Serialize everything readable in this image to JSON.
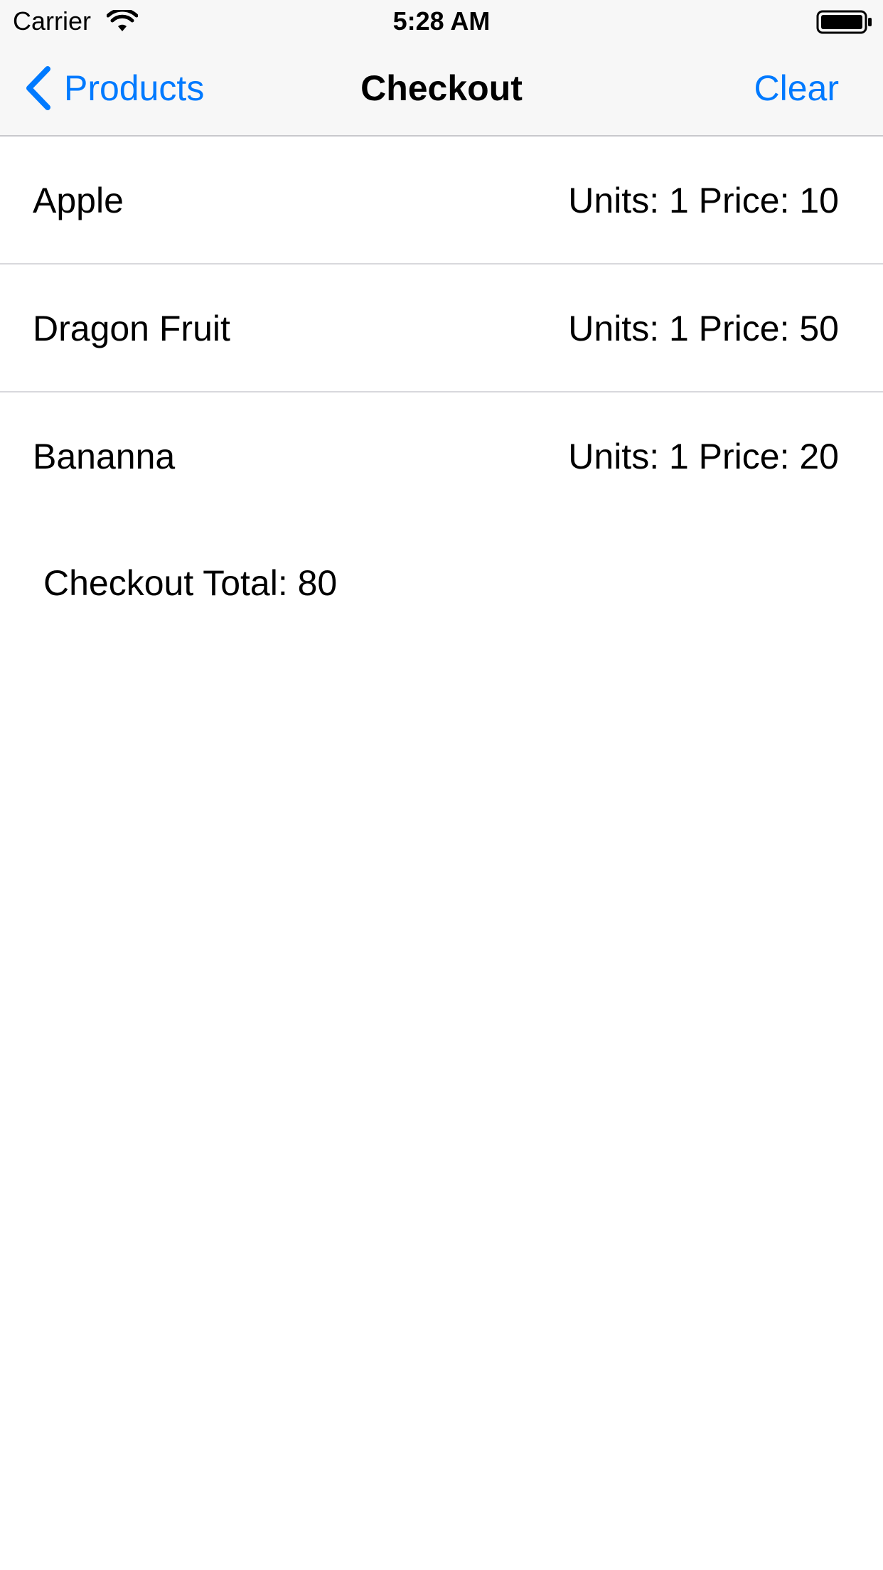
{
  "status_bar": {
    "carrier": "Carrier",
    "time": "5:28 AM"
  },
  "nav": {
    "back_label": "Products",
    "title": "Checkout",
    "right_action": "Clear"
  },
  "items": [
    {
      "name": "Apple",
      "detail": "Units: 1 Price: 10"
    },
    {
      "name": "Dragon Fruit",
      "detail": "Units: 1 Price: 50"
    },
    {
      "name": "Bananna",
      "detail": "Units: 1 Price: 20"
    }
  ],
  "total_label": "Checkout Total: 80",
  "colors": {
    "accent": "#007aff",
    "bar_background": "#f7f7f7",
    "separator": "#d8d8dc"
  },
  "icons": {
    "wifi": "wifi-icon",
    "battery": "battery-icon",
    "back": "chevron-left-icon"
  }
}
